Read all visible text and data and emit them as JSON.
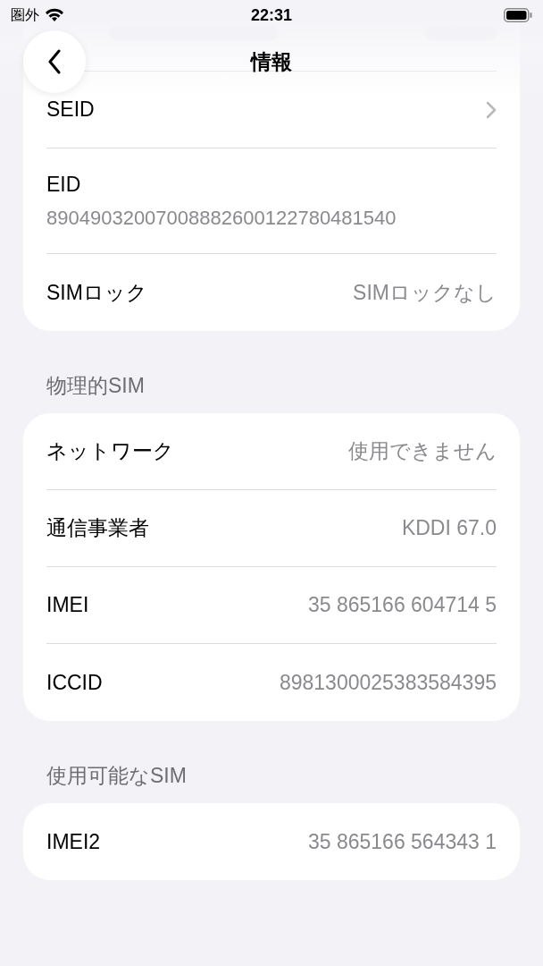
{
  "status_bar": {
    "carrier": "圏外",
    "time": "22:31"
  },
  "nav": {
    "title": "情報"
  },
  "sections": [
    {
      "rows": [
        {
          "kind": "nav",
          "label": "SEID"
        },
        {
          "kind": "stacked",
          "label": "EID",
          "value": "89049032007008882600122780481540"
        },
        {
          "kind": "value",
          "label": "SIMロック",
          "value": "SIMロックなし"
        }
      ]
    },
    {
      "header": "物理的SIM",
      "rows": [
        {
          "kind": "value",
          "label": "ネットワーク",
          "value": "使用できません"
        },
        {
          "kind": "value",
          "label": "通信事業者",
          "value": "KDDI 67.0"
        },
        {
          "kind": "value",
          "label": "IMEI",
          "value": "35 865166 604714 5"
        },
        {
          "kind": "value",
          "label": "ICCID",
          "value": "8981300025383584395"
        }
      ]
    },
    {
      "header": "使用可能なSIM",
      "rows": [
        {
          "kind": "value",
          "label": "IMEI2",
          "value": "35 865166 564343 1"
        }
      ]
    }
  ]
}
